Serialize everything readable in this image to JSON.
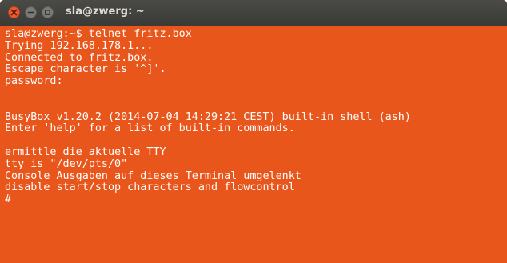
{
  "window": {
    "title": "sla@zwerg: ~"
  },
  "terminal": {
    "background": "#E8561C",
    "foreground": "#FFFFFF",
    "lines": [
      "sla@zwerg:~$ telnet fritz.box",
      "Trying 192.168.178.1...",
      "Connected to fritz.box.",
      "Escape character is '^]'.",
      "password:",
      "",
      "",
      "BusyBox v1.20.2 (2014-07-04 14:29:21 CEST) built-in shell (ash)",
      "Enter 'help' for a list of built-in commands.",
      "",
      "ermittle die aktuelle TTY",
      "tty is \"/dev/pts/0\"",
      "Console Ausgaben auf dieses Terminal umgelenkt",
      "disable start/stop characters and flowcontrol",
      "#"
    ]
  },
  "icons": {
    "close": "close-icon",
    "minimize": "minimize-icon",
    "maximize": "maximize-icon"
  },
  "colors": {
    "close_button": "#EA5A2F",
    "titlebar": "#3C3C3A",
    "title_text": "#DFDBD2"
  }
}
